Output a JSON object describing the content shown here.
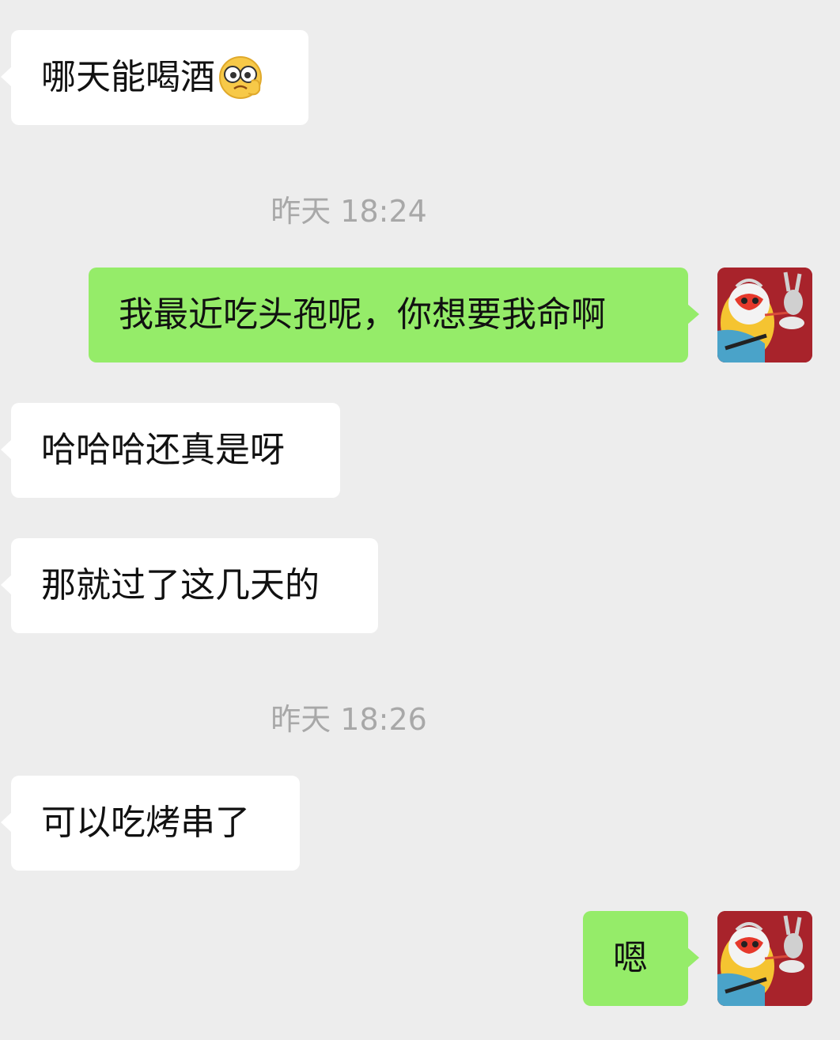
{
  "chat": {
    "messages": [
      {
        "side": "in",
        "text": "哪天能喝酒",
        "emoji": "peeking-face-emoji"
      },
      {
        "side": "timestamp",
        "text": "昨天 18:24"
      },
      {
        "side": "out",
        "text": "我最近吃头孢呢，你想要我命啊"
      },
      {
        "side": "in",
        "text": "哈哈哈还真是呀"
      },
      {
        "side": "in",
        "text": "那就过了这几天的"
      },
      {
        "side": "timestamp",
        "text": "昨天 18:26"
      },
      {
        "side": "in",
        "text": "可以吃烤串了"
      },
      {
        "side": "out",
        "text": "嗯"
      }
    ]
  },
  "colors": {
    "background": "#ededed",
    "incoming_bubble": "#ffffff",
    "outgoing_bubble": "#95ec69",
    "timestamp_text": "#a8a8a8",
    "avatar_background": "#a8232b"
  }
}
